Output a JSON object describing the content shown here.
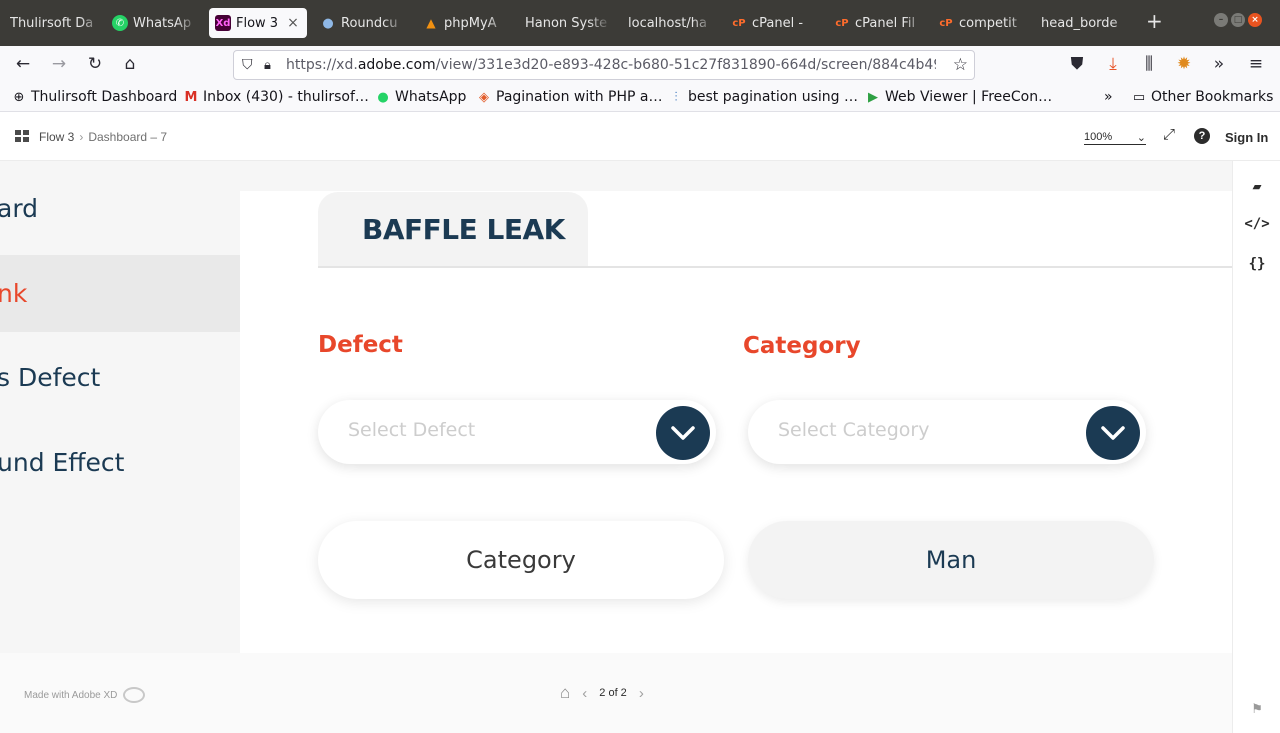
{
  "browser": {
    "tabs": [
      {
        "label": "Thulirsoft Da",
        "icon": "none"
      },
      {
        "label": "WhatsAp",
        "icon": "whatsapp-icon"
      },
      {
        "label": "Flow 3",
        "icon": "adobe-xd-icon",
        "active": true
      },
      {
        "label": "Roundcu",
        "icon": "roundcube-icon"
      },
      {
        "label": "phpMyA",
        "icon": "phpmyadmin-icon"
      },
      {
        "label": "Hanon Syste",
        "icon": "none"
      },
      {
        "label": "localhost/ha",
        "icon": "none"
      },
      {
        "label": "cPanel - ",
        "icon": "cpanel-icon"
      },
      {
        "label": "cPanel Fil",
        "icon": "cpanel-icon"
      },
      {
        "label": "competit",
        "icon": "cpanel-icon"
      },
      {
        "label": "head_borde",
        "icon": "none"
      }
    ],
    "close_tab_glyph": "×",
    "new_tab_glyph": "+",
    "url_prefix": "https://xd.",
    "url_domain": "adobe.com",
    "url_rest": "/view/331e3d20-e893-428c-b680-51c27f831890-664d/screen/884c4b49-",
    "bookmarks": [
      {
        "label": "Thulirsoft Dashboard",
        "icon": "globe-icon"
      },
      {
        "label": "Inbox (430) - thulirsof…",
        "icon": "gmail-icon"
      },
      {
        "label": "WhatsApp",
        "icon": "whatsapp-icon"
      },
      {
        "label": "Pagination with PHP a…",
        "icon": "diamond-icon"
      },
      {
        "label": "best pagination using …",
        "icon": "chart-icon"
      },
      {
        "label": "Web Viewer | FreeCon…",
        "icon": "play-icon"
      }
    ],
    "overflow_glyph": "»",
    "other_bookmarks": "Other Bookmarks"
  },
  "xd": {
    "breadcrumb": {
      "flow": "Flow 3",
      "screen": "Dashboard – 7"
    },
    "zoom": "100%",
    "sign_in": "Sign In",
    "made_with": "Made with Adobe XD",
    "pager": "2 of 2"
  },
  "sidebar": {
    "items": [
      {
        "label": "ard",
        "active": false
      },
      {
        "label": "nk",
        "active": true
      },
      {
        "label": "s Defect",
        "active": false
      },
      {
        "label": "und Effect",
        "active": false
      }
    ]
  },
  "main": {
    "tab_title": "BAFFLE LEAK",
    "defect_label": "Defect",
    "category_label": "Category",
    "defect_placeholder": "Select Defect",
    "category_placeholder": "Select Category",
    "button_category": "Category",
    "button_man": "Man"
  },
  "colors": {
    "accent": "#e8472b",
    "navy": "#1b3a53"
  }
}
